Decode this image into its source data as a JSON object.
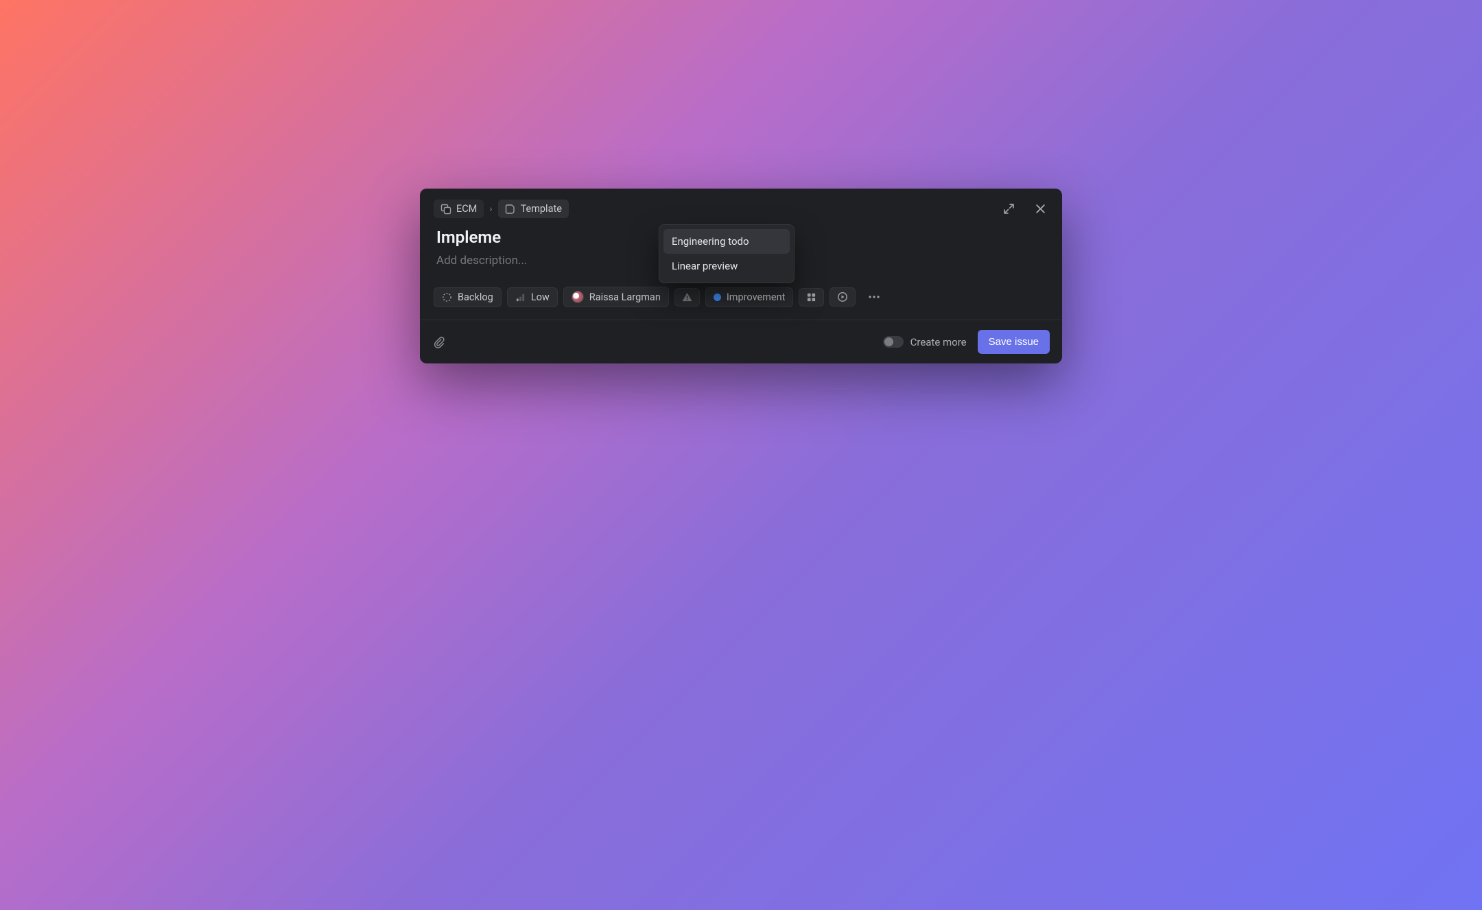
{
  "breadcrumb": {
    "project": "ECM",
    "template_label": "Template"
  },
  "dropdown": {
    "items": [
      "Engineering todo",
      "Linear preview"
    ]
  },
  "issue": {
    "title": "Impleme",
    "description_placeholder": "Add description..."
  },
  "properties": {
    "status": "Backlog",
    "priority": "Low",
    "assignee": "Raissa Largman",
    "label": "Improvement"
  },
  "footer": {
    "create_more": "Create more",
    "save": "Save issue"
  }
}
